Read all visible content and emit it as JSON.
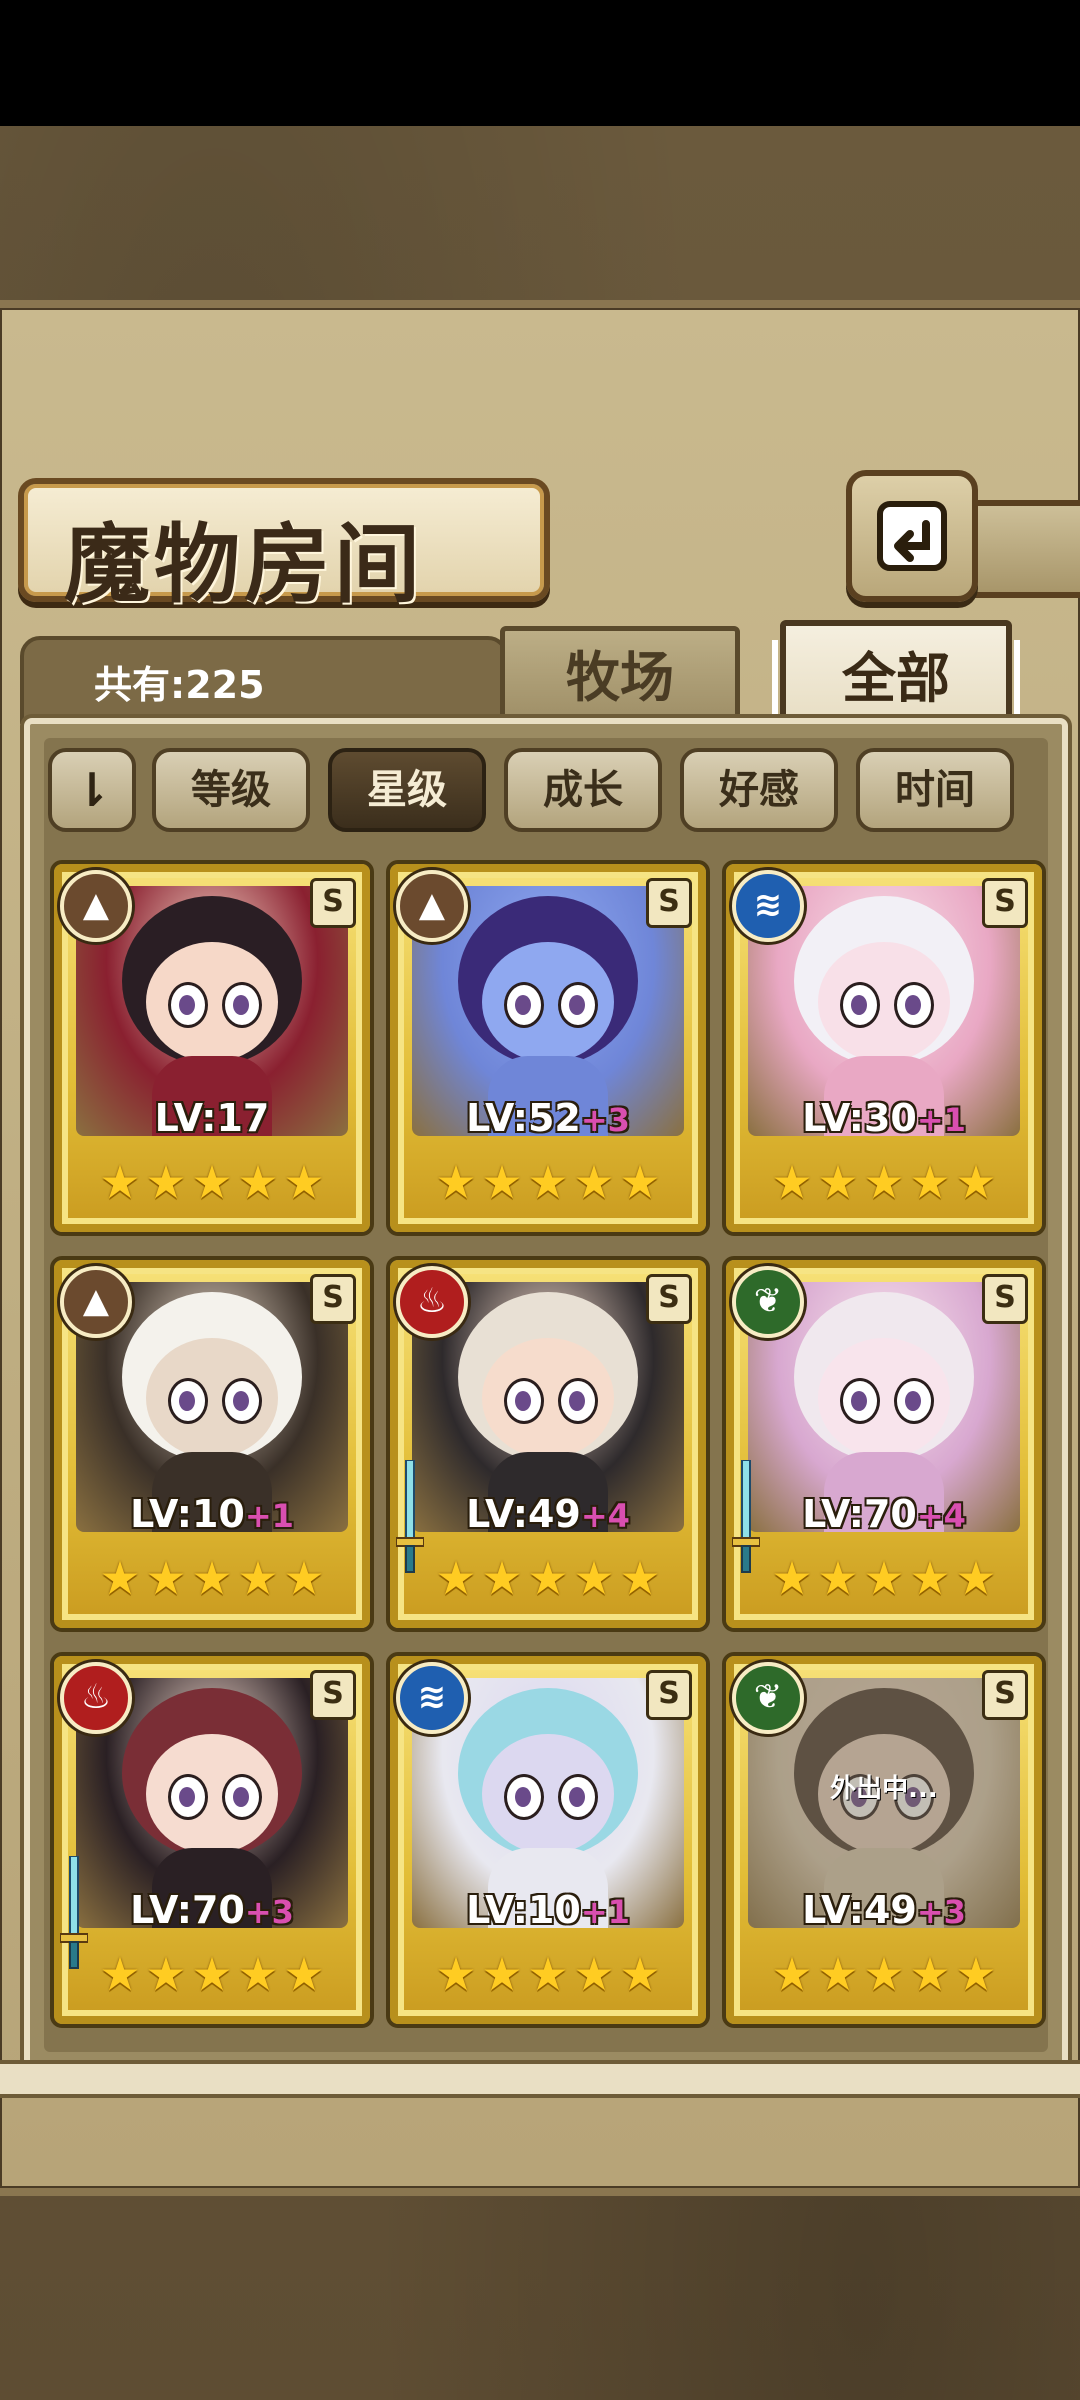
{
  "header": {
    "title": "魔物房间",
    "total_label": "共有:225"
  },
  "tabs": [
    {
      "label": "牧场",
      "active": false
    },
    {
      "label": "全部",
      "active": true
    }
  ],
  "sort": {
    "toggle_icon": "sort-direction-icon",
    "toggle_label": "⇂",
    "buttons": [
      {
        "label": "等级",
        "active": false
      },
      {
        "label": "星级",
        "active": true
      },
      {
        "label": "成长",
        "active": false
      },
      {
        "label": "好感",
        "active": false
      },
      {
        "label": "时间",
        "active": false
      }
    ]
  },
  "monsters": [
    {
      "level": "LV:17",
      "plus": "",
      "element": "earth",
      "element_color": "#6b4a2e",
      "grade": "S",
      "stars": 5,
      "weapon": false,
      "away": false,
      "palette": [
        "#2a1e24",
        "#8a2030",
        "#f6d8c8"
      ]
    },
    {
      "level": "LV:52",
      "plus": "+3",
      "element": "earth",
      "element_color": "#6b4a2e",
      "grade": "S",
      "stars": 5,
      "weapon": false,
      "away": false,
      "palette": [
        "#3a2a78",
        "#6f86d8",
        "#8fa8f0"
      ]
    },
    {
      "level": "LV:30",
      "plus": "+1",
      "element": "water",
      "element_color": "#1f5fb0",
      "grade": "S",
      "stars": 5,
      "weapon": false,
      "away": false,
      "palette": [
        "#f2f0f6",
        "#e9a8c4",
        "#f8e0e8"
      ]
    },
    {
      "level": "LV:10",
      "plus": "+1",
      "element": "earth",
      "element_color": "#6b4a2e",
      "grade": "S",
      "stars": 5,
      "weapon": false,
      "away": false,
      "palette": [
        "#f4f2ec",
        "#3a3028",
        "#e8d8c8"
      ]
    },
    {
      "level": "LV:49",
      "plus": "+4",
      "element": "fire",
      "element_color": "#b01e1e",
      "grade": "S",
      "stars": 5,
      "weapon": true,
      "away": false,
      "palette": [
        "#e8e0d4",
        "#2e2a2c",
        "#f6dccc"
      ]
    },
    {
      "level": "LV:70",
      "plus": "+4",
      "element": "wood",
      "element_color": "#2e6a2a",
      "grade": "S",
      "stars": 5,
      "weapon": true,
      "away": false,
      "palette": [
        "#f0e8ee",
        "#d8a8d0",
        "#f8e4ec"
      ]
    },
    {
      "level": "LV:70",
      "plus": "+3",
      "element": "fire",
      "element_color": "#b01e1e",
      "grade": "S",
      "stars": 5,
      "weapon": true,
      "away": false,
      "palette": [
        "#7a2e36",
        "#2a2024",
        "#f6dcd0"
      ]
    },
    {
      "level": "LV:10",
      "plus": "+1",
      "element": "water",
      "element_color": "#1f5fb0",
      "grade": "S",
      "stars": 5,
      "weapon": false,
      "away": false,
      "palette": [
        "#9ad8e4",
        "#e8e8f0",
        "#dcd8f0"
      ]
    },
    {
      "level": "LV:49",
      "plus": "+3",
      "element": "wood",
      "element_color": "#2e6a2a",
      "grade": "S",
      "stars": 5,
      "weapon": false,
      "away": true,
      "away_label": "外出中...",
      "palette": [
        "#4a3a30",
        "#d8c8b0",
        "#e8d0c0"
      ]
    }
  ],
  "element_icons": {
    "earth": "mountain-icon",
    "water": "wave-icon",
    "fire": "flame-icon",
    "wood": "leaf-icon"
  },
  "star_glyph": "★"
}
